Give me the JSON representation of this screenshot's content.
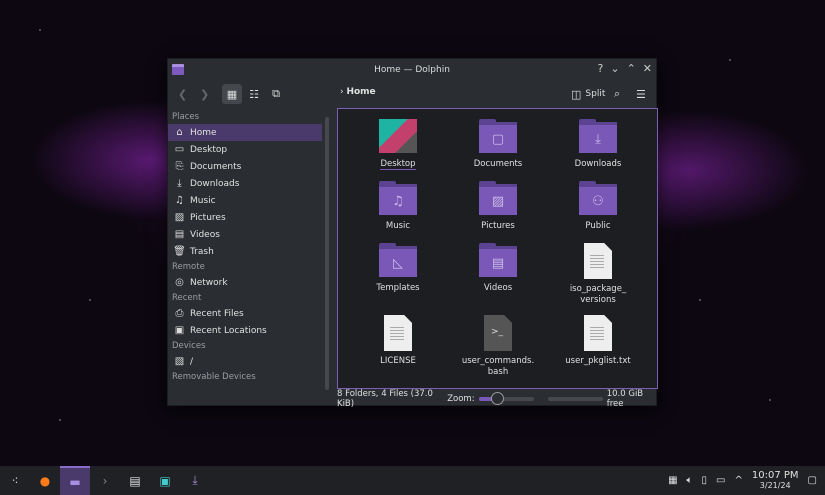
{
  "window": {
    "title": "Home — Dolphin",
    "controls": [
      "?",
      "⌄",
      "⌃",
      "✕"
    ]
  },
  "toolbar": {
    "breadcrumb": "Home",
    "split_label": "Split"
  },
  "sidebar": {
    "sections": [
      {
        "label": "Places",
        "items": [
          {
            "label": "Home",
            "icon": "home-icon",
            "active": true
          },
          {
            "label": "Desktop",
            "icon": "desktop-icon"
          },
          {
            "label": "Documents",
            "icon": "documents-icon"
          },
          {
            "label": "Downloads",
            "icon": "download-icon"
          },
          {
            "label": "Music",
            "icon": "music-icon"
          },
          {
            "label": "Pictures",
            "icon": "pictures-icon"
          },
          {
            "label": "Videos",
            "icon": "videos-icon"
          },
          {
            "label": "Trash",
            "icon": "trash-icon"
          }
        ]
      },
      {
        "label": "Remote",
        "items": [
          {
            "label": "Network",
            "icon": "network-icon"
          }
        ]
      },
      {
        "label": "Recent",
        "items": [
          {
            "label": "Recent Files",
            "icon": "recent-files-icon"
          },
          {
            "label": "Recent Locations",
            "icon": "recent-locations-icon"
          }
        ]
      },
      {
        "label": "Devices",
        "items": [
          {
            "label": "/",
            "icon": "drive-icon"
          }
        ]
      },
      {
        "label": "Removable Devices",
        "items": []
      }
    ]
  },
  "files": [
    {
      "name": "Desktop",
      "type": "desktop"
    },
    {
      "name": "Documents",
      "type": "folder",
      "glyph": "▢"
    },
    {
      "name": "Downloads",
      "type": "folder",
      "glyph": "⤓"
    },
    {
      "name": "Music",
      "type": "folder",
      "glyph": "♫"
    },
    {
      "name": "Pictures",
      "type": "folder",
      "glyph": "▨"
    },
    {
      "name": "Public",
      "type": "folder",
      "glyph": "⚇"
    },
    {
      "name": "Templates",
      "type": "folder",
      "glyph": "◺"
    },
    {
      "name": "Videos",
      "type": "folder",
      "glyph": "▤"
    },
    {
      "name": "iso_package_ versions",
      "type": "text"
    },
    {
      "name": "LICENSE",
      "type": "text"
    },
    {
      "name": "user_commands. bash",
      "type": "script"
    },
    {
      "name": "user_pkglist.txt",
      "type": "text"
    }
  ],
  "status": {
    "summary": "8 Folders, 4 Files (37.0 KiB)",
    "zoom_label": "Zoom:",
    "zoom_level": 0.3,
    "free_space": "10.0 GiB free",
    "disk_used_fraction": 0.0
  },
  "taskbar": {
    "clock_time": "10:07 PM",
    "clock_date": "3/21/24"
  },
  "colors": {
    "accent": "#7a58b8",
    "folder": "#7a58b8",
    "selection": "#4a3a6b"
  }
}
